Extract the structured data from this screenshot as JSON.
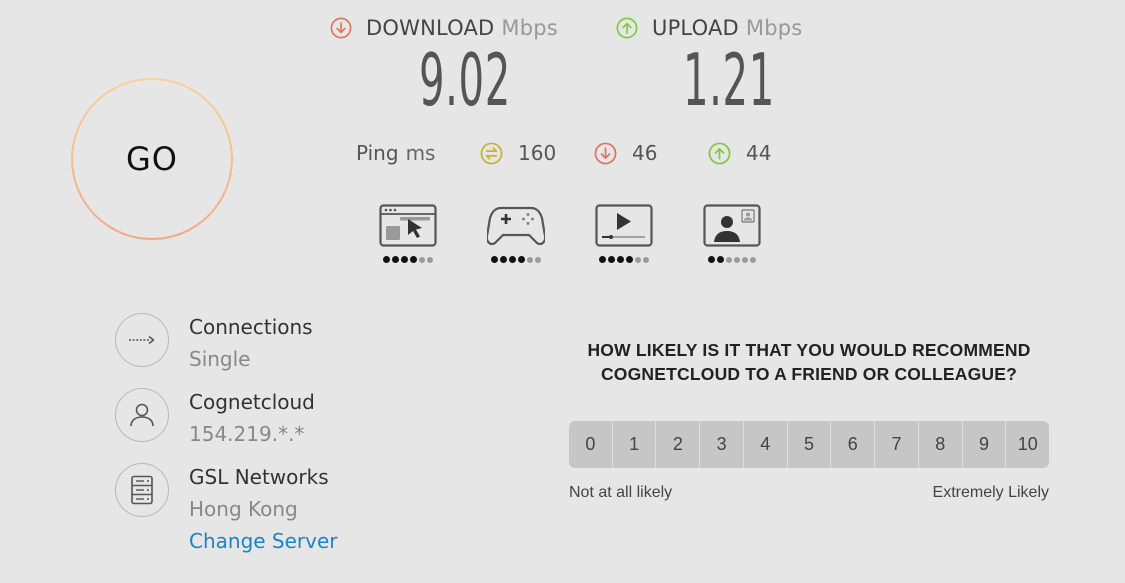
{
  "go": {
    "label": "GO"
  },
  "download": {
    "label": "DOWNLOAD",
    "unit": "Mbps",
    "value": "9.02"
  },
  "upload": {
    "label": "UPLOAD",
    "unit": "Mbps",
    "value": "1.21"
  },
  "ping": {
    "label": "Ping",
    "unit": "ms",
    "idle": "160",
    "download": "46",
    "upload": "44"
  },
  "usage": {
    "browsing": {
      "icon": "browsing-icon",
      "rating": 4,
      "max": 6
    },
    "gaming": {
      "icon": "gaming-icon",
      "rating": 4,
      "max": 6
    },
    "streaming": {
      "icon": "streaming-icon",
      "rating": 4,
      "max": 6
    },
    "video_chat": {
      "icon": "video-chat-icon",
      "rating": 2,
      "max": 6
    }
  },
  "connections": {
    "title": "Connections",
    "value": "Single"
  },
  "provider": {
    "title": "Cognetcloud",
    "ip": "154.219.*.*"
  },
  "server": {
    "title": "GSL Networks",
    "location": "Hong Kong",
    "change_label": "Change Server"
  },
  "survey": {
    "question": "HOW LIKELY IS IT THAT YOU WOULD RECOMMEND COGNETCLOUD TO A FRIEND OR COLLEAGUE?",
    "scale": [
      "0",
      "1",
      "2",
      "3",
      "4",
      "5",
      "6",
      "7",
      "8",
      "9",
      "10"
    ],
    "low_label": "Not at all likely",
    "high_label": "Extremely Likely"
  },
  "colors": {
    "download": "#e0735c",
    "upload": "#7ecb3a",
    "ping": "#c9b12c",
    "link": "#1a84c9"
  }
}
